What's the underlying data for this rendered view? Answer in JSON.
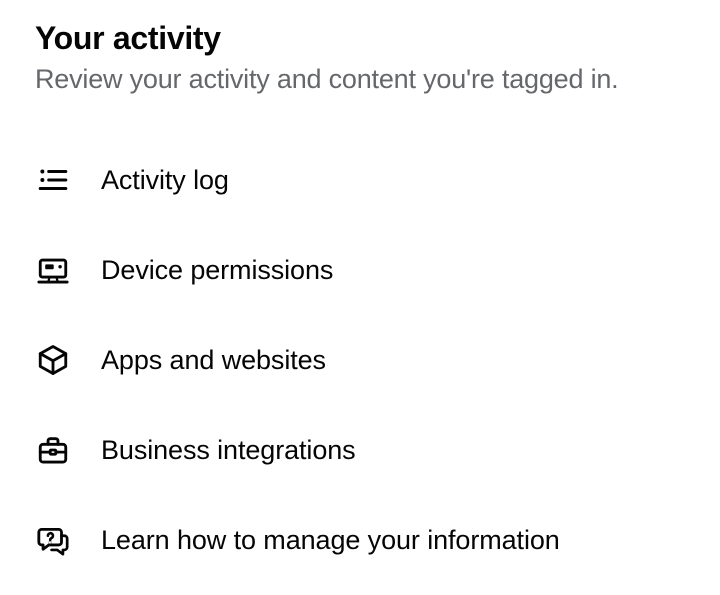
{
  "header": {
    "title": "Your activity",
    "subtitle": "Review your activity and content you're tagged in."
  },
  "menu": {
    "items": [
      {
        "label": "Activity log",
        "icon": "list-icon"
      },
      {
        "label": "Device permissions",
        "icon": "device-icon"
      },
      {
        "label": "Apps and websites",
        "icon": "cube-icon"
      },
      {
        "label": "Business integrations",
        "icon": "briefcase-icon"
      },
      {
        "label": "Learn how to manage your information",
        "icon": "help-chat-icon"
      }
    ]
  }
}
